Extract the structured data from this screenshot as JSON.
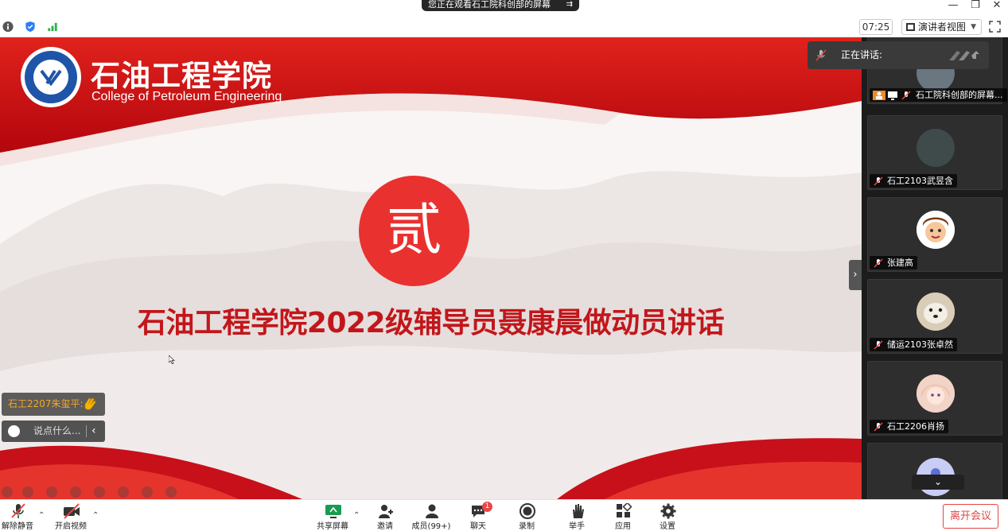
{
  "banner": {
    "text": "您正在观看石工院科创部的屏幕",
    "icon": "options-icon"
  },
  "window_controls": [
    "minimize-icon",
    "restore-icon",
    "close-icon"
  ],
  "status": {
    "timer": "07:25",
    "view_mode": "演讲者视图",
    "icons": [
      "info-icon",
      "shield-icon",
      "signal-icon"
    ]
  },
  "slide": {
    "college_cn": "石油工程学院",
    "college_en": "College of Petroleum Engineering",
    "section_number": "贰",
    "headline": "石油工程学院2022级辅导员聂康晨做动员讲话",
    "colors": {
      "red": "#e9312f",
      "dark_red": "#c2161b"
    }
  },
  "reaction": {
    "text": "石工2207朱玺平:",
    "icon": "clap-icon"
  },
  "chat_input": {
    "placeholder": "说点什么..."
  },
  "speaking": {
    "label": "正在讲话:"
  },
  "participants": [
    {
      "name": "石工院科创部的屏幕..."
    },
    {
      "name": "石工2103武昱含"
    },
    {
      "name": "张建高"
    },
    {
      "name": "储运2103张卓然"
    },
    {
      "name": "石工2206肖扬"
    },
    {
      "name": ""
    }
  ],
  "toolbar": {
    "left": [
      {
        "label": "解除静音",
        "icon": "mic-muted-icon"
      },
      {
        "label": "开启视频",
        "icon": "video-off-icon"
      }
    ],
    "center": [
      {
        "label": "共享屏幕",
        "icon": "share-screen-icon"
      },
      {
        "label": "邀请",
        "icon": "invite-icon"
      },
      {
        "label": "成员(99+)",
        "icon": "members-icon"
      },
      {
        "label": "聊天",
        "icon": "chat-icon",
        "badge": "1"
      },
      {
        "label": "录制",
        "icon": "record-icon"
      },
      {
        "label": "举手",
        "icon": "raise-hand-icon"
      },
      {
        "label": "应用",
        "icon": "apps-icon"
      },
      {
        "label": "设置",
        "icon": "settings-icon"
      }
    ],
    "leave": "离开会议"
  }
}
